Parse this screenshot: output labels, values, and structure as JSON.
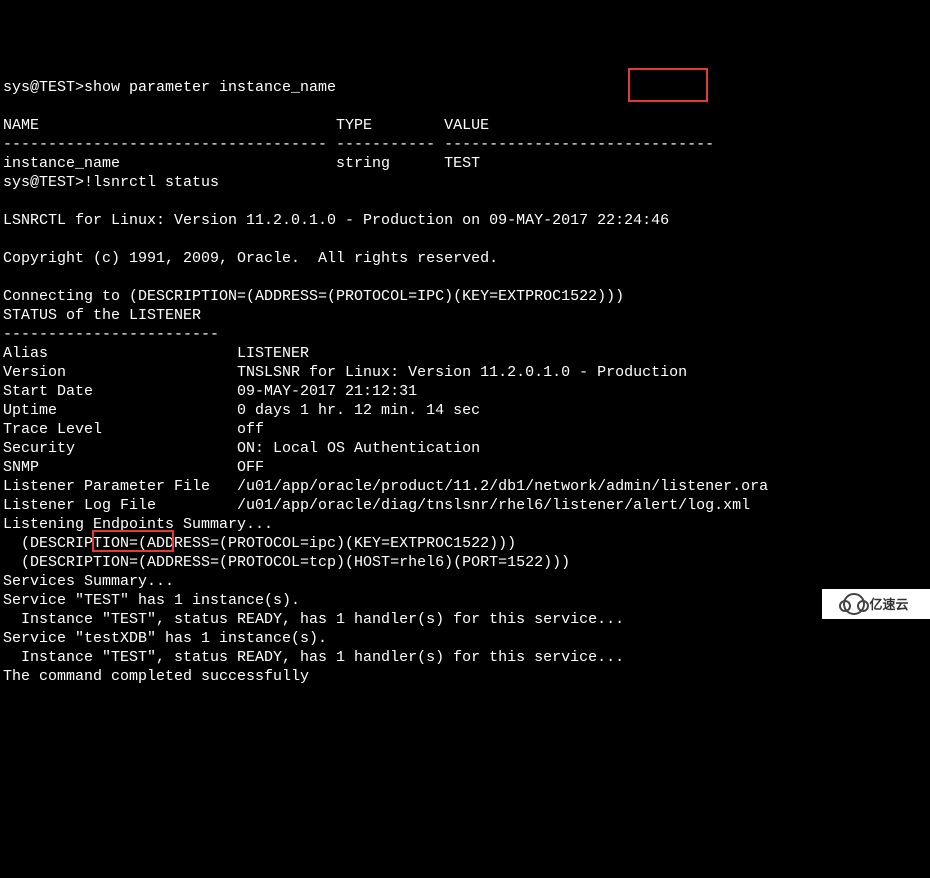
{
  "prompt1": "sys@TEST>show parameter instance_name",
  "blank": "",
  "header": "NAME                                 TYPE        VALUE",
  "divider": "------------------------------------ ----------- ------------------------------",
  "param_line": "instance_name                        string      TEST",
  "prompt2": "sys@TEST>!lsnrctl status",
  "lsnrctl_version": "LSNRCTL for Linux: Version 11.2.0.1.0 - Production on 09-MAY-2017 22:24:46",
  "copyright": "Copyright (c) 1991, 2009, Oracle.  All rights reserved.",
  "connecting": "Connecting to (DESCRIPTION=(ADDRESS=(PROTOCOL=IPC)(KEY=EXTPROC1522)))",
  "status_hdr": "STATUS of the LISTENER",
  "dash_small": "------------------------",
  "alias": "Alias                     LISTENER",
  "version": "Version                   TNSLSNR for Linux: Version 11.2.0.1.0 - Production",
  "start_date": "Start Date                09-MAY-2017 21:12:31",
  "uptime": "Uptime                    0 days 1 hr. 12 min. 14 sec",
  "trace": "Trace Level               off",
  "security": "Security                  ON: Local OS Authentication",
  "snmp": "SNMP                      OFF",
  "param_file": "Listener Parameter File   /u01/app/oracle/product/11.2/db1/network/admin/listener.ora",
  "log_file": "Listener Log File         /u01/app/oracle/diag/tnslsnr/rhel6/listener/alert/log.xml",
  "endpoints": "Listening Endpoints Summary...",
  "ep1": "  (DESCRIPTION=(ADDRESS=(PROTOCOL=ipc)(KEY=EXTPROC1522)))",
  "ep2": "  (DESCRIPTION=(ADDRESS=(PROTOCOL=tcp)(HOST=rhel6)(PORT=1522)))",
  "services": "Services Summary...",
  "svc1": "Service \"TEST\" has 1 instance(s).",
  "inst1": "  Instance \"TEST\", status READY, has 1 handler(s) for this service...",
  "svc2": "Service \"testXDB\" has 1 instance(s).",
  "inst2": "  Instance \"TEST\", status READY, has 1 handler(s) for this service...",
  "done": "The command completed successfully",
  "watermark": "亿速云"
}
